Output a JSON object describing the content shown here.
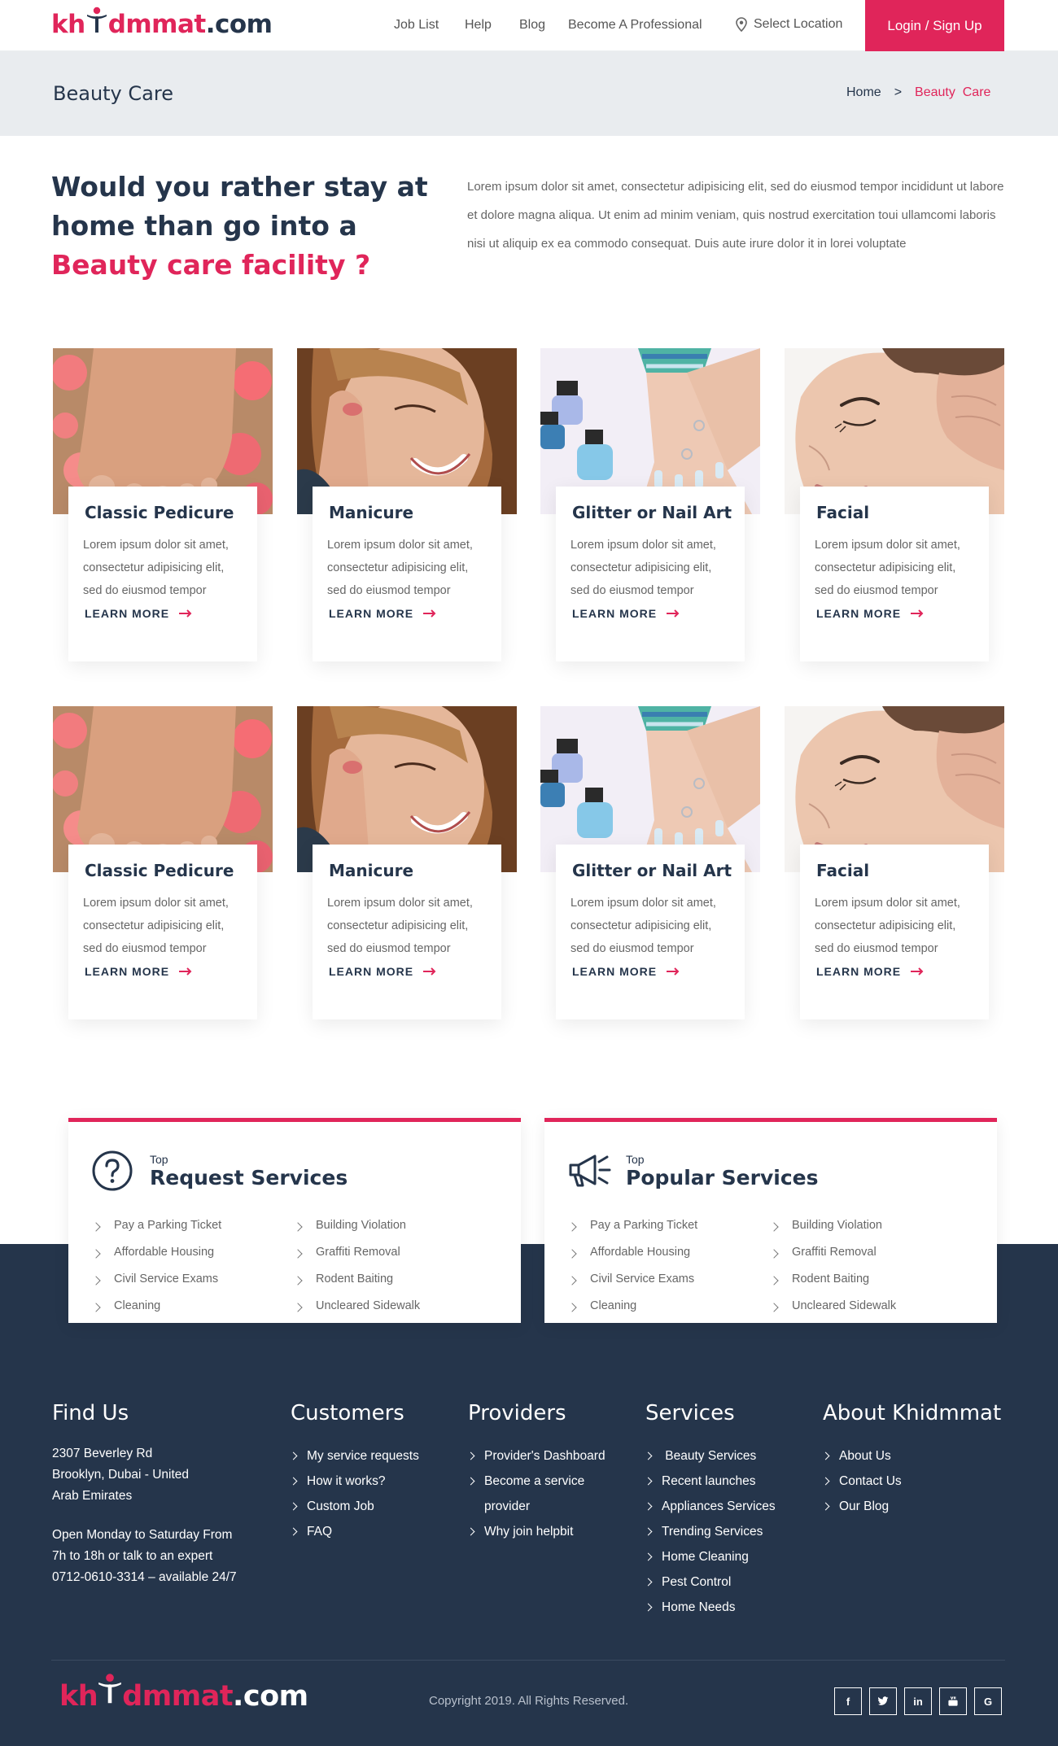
{
  "header": {
    "logo": {
      "part1": "kh",
      "part2": "dmmat",
      "part3": ".com"
    },
    "nav": [
      "Job List",
      "Help",
      "Blog",
      "Become A Professional"
    ],
    "location_label": "Select Location",
    "login_label": "Login / Sign Up"
  },
  "titlebar": {
    "title": "Beauty Care",
    "breadcrumb": {
      "home": "Home",
      "separator": ">",
      "current": "Beauty  Care"
    }
  },
  "intro": {
    "heading_plain": "Would you rather stay at home than go into a ",
    "heading_accent": "Beauty care facility ?",
    "body": "Lorem ipsum dolor sit amet, consectetur adipisicing elit, sed do eiusmod tempor incididunt ut labore et dolore magna aliqua. Ut enim ad minim veniam, quis nostrud exercitation toui ullamcomi laboris nisi ut aliquip ex ea commodo consequat. Duis aute irure dolor it in lorei voluptate"
  },
  "cards": [
    {
      "title": "Classic Pedicure",
      "body": "Lorem ipsum dolor sit amet, consectetur adipisicing elit, sed do eiusmod tempor",
      "link": "LEARN MORE",
      "image_icon": "pedicure-photo"
    },
    {
      "title": "Manicure",
      "body": "Lorem ipsum dolor sit amet, consectetur adipisicing elit, sed do eiusmod tempor",
      "link": "LEARN MORE",
      "image_icon": "manicure-photo"
    },
    {
      "title": "Glitter or Nail Art",
      "body": "Lorem ipsum dolor sit amet, consectetur adipisicing elit, sed do eiusmod tempor",
      "link": "LEARN MORE",
      "image_icon": "nail-art-photo"
    },
    {
      "title": "Facial",
      "body": "Lorem ipsum dolor sit amet, consectetur adipisicing elit, sed do eiusmod tempor",
      "link": "LEARN MORE",
      "image_icon": "facial-photo"
    },
    {
      "title": "Classic Pedicure",
      "body": "Lorem ipsum dolor sit amet, consectetur adipisicing elit, sed do eiusmod tempor",
      "link": "LEARN MORE",
      "image_icon": "pedicure-photo"
    },
    {
      "title": "Manicure",
      "body": "Lorem ipsum dolor sit amet, consectetur adipisicing elit, sed do eiusmod tempor",
      "link": "LEARN MORE",
      "image_icon": "manicure-photo"
    },
    {
      "title": "Glitter or Nail Art",
      "body": "Lorem ipsum dolor sit amet, consectetur adipisicing elit, sed do eiusmod tempor",
      "link": "LEARN MORE",
      "image_icon": "nail-art-photo"
    },
    {
      "title": "Facial",
      "body": "Lorem ipsum dolor sit amet, consectetur adipisicing elit, sed do eiusmod tempor",
      "link": "LEARN MORE",
      "image_icon": "facial-photo"
    }
  ],
  "top_sections": [
    {
      "label": "Top",
      "title": "Request Services",
      "icon": "question-circle-icon",
      "col1": [
        "Pay a Parking Ticket",
        "Affordable Housing",
        "Civil Service Exams",
        "Cleaning"
      ],
      "col2": [
        "Building Violation",
        "Graffiti Removal",
        "Rodent Baiting",
        "Uncleared Sidewalk"
      ]
    },
    {
      "label": "Top",
      "title": "Popular Services",
      "icon": "megaphone-icon",
      "col1": [
        "Pay a Parking Ticket",
        "Affordable Housing",
        "Civil Service Exams",
        "Cleaning"
      ],
      "col2": [
        "Building Violation",
        "Graffiti Removal",
        "Rodent Baiting",
        "Uncleared Sidewalk"
      ]
    }
  ],
  "footer": {
    "find_us": {
      "title": "Find Us",
      "address": [
        "2307 Beverley Rd",
        "Brooklyn, Dubai - United",
        "Arab Emirates"
      ],
      "hours": [
        "Open Monday to Saturday From",
        "7h to 18h or talk to an expert",
        "0712-0610-3314 – available 24/7"
      ]
    },
    "customers": {
      "title": "Customers",
      "items": [
        "My service requests",
        "How it works?",
        "Custom Job",
        "FAQ"
      ]
    },
    "providers": {
      "title": "Providers",
      "items": [
        "Provider's Dashboard",
        "Become a service provider",
        "Why join helpbit"
      ]
    },
    "services": {
      "title": "Services",
      "items": [
        " Beauty Services",
        "Recent launches",
        "Appliances Services",
        "Trending Services",
        "Home Cleaning",
        "Pest Control",
        "Home Needs"
      ]
    },
    "about": {
      "title": "About Khidmmat",
      "items": [
        "About Us",
        "Contact Us",
        "Our Blog"
      ]
    },
    "copyright": "Copyright 2019. All Rights Reserved.",
    "socials": [
      {
        "icon": "facebook-icon",
        "glyph": "f"
      },
      {
        "icon": "twitter-icon",
        "glyph": "t"
      },
      {
        "icon": "linkedin-icon",
        "glyph": "in"
      },
      {
        "icon": "youtube-icon",
        "glyph": "▶"
      },
      {
        "icon": "google-icon",
        "glyph": "G"
      }
    ]
  },
  "colors": {
    "accent": "#e0255a",
    "navy": "#25354b",
    "titlebar_bg": "#e9ecef"
  }
}
